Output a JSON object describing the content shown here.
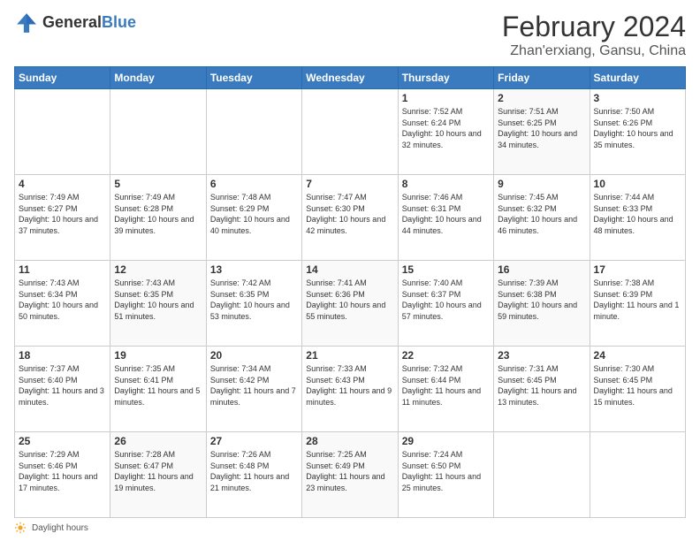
{
  "header": {
    "logo_general": "General",
    "logo_blue": "Blue",
    "title": "February 2024",
    "location": "Zhan'erxiang, Gansu, China"
  },
  "weekdays": [
    "Sunday",
    "Monday",
    "Tuesday",
    "Wednesday",
    "Thursday",
    "Friday",
    "Saturday"
  ],
  "weeks": [
    [
      {
        "day": "",
        "info": ""
      },
      {
        "day": "",
        "info": ""
      },
      {
        "day": "",
        "info": ""
      },
      {
        "day": "",
        "info": ""
      },
      {
        "day": "1",
        "info": "Sunrise: 7:52 AM\nSunset: 6:24 PM\nDaylight: 10 hours and 32 minutes."
      },
      {
        "day": "2",
        "info": "Sunrise: 7:51 AM\nSunset: 6:25 PM\nDaylight: 10 hours and 34 minutes."
      },
      {
        "day": "3",
        "info": "Sunrise: 7:50 AM\nSunset: 6:26 PM\nDaylight: 10 hours and 35 minutes."
      }
    ],
    [
      {
        "day": "4",
        "info": "Sunrise: 7:49 AM\nSunset: 6:27 PM\nDaylight: 10 hours and 37 minutes."
      },
      {
        "day": "5",
        "info": "Sunrise: 7:49 AM\nSunset: 6:28 PM\nDaylight: 10 hours and 39 minutes."
      },
      {
        "day": "6",
        "info": "Sunrise: 7:48 AM\nSunset: 6:29 PM\nDaylight: 10 hours and 40 minutes."
      },
      {
        "day": "7",
        "info": "Sunrise: 7:47 AM\nSunset: 6:30 PM\nDaylight: 10 hours and 42 minutes."
      },
      {
        "day": "8",
        "info": "Sunrise: 7:46 AM\nSunset: 6:31 PM\nDaylight: 10 hours and 44 minutes."
      },
      {
        "day": "9",
        "info": "Sunrise: 7:45 AM\nSunset: 6:32 PM\nDaylight: 10 hours and 46 minutes."
      },
      {
        "day": "10",
        "info": "Sunrise: 7:44 AM\nSunset: 6:33 PM\nDaylight: 10 hours and 48 minutes."
      }
    ],
    [
      {
        "day": "11",
        "info": "Sunrise: 7:43 AM\nSunset: 6:34 PM\nDaylight: 10 hours and 50 minutes."
      },
      {
        "day": "12",
        "info": "Sunrise: 7:43 AM\nSunset: 6:35 PM\nDaylight: 10 hours and 51 minutes."
      },
      {
        "day": "13",
        "info": "Sunrise: 7:42 AM\nSunset: 6:35 PM\nDaylight: 10 hours and 53 minutes."
      },
      {
        "day": "14",
        "info": "Sunrise: 7:41 AM\nSunset: 6:36 PM\nDaylight: 10 hours and 55 minutes."
      },
      {
        "day": "15",
        "info": "Sunrise: 7:40 AM\nSunset: 6:37 PM\nDaylight: 10 hours and 57 minutes."
      },
      {
        "day": "16",
        "info": "Sunrise: 7:39 AM\nSunset: 6:38 PM\nDaylight: 10 hours and 59 minutes."
      },
      {
        "day": "17",
        "info": "Sunrise: 7:38 AM\nSunset: 6:39 PM\nDaylight: 11 hours and 1 minute."
      }
    ],
    [
      {
        "day": "18",
        "info": "Sunrise: 7:37 AM\nSunset: 6:40 PM\nDaylight: 11 hours and 3 minutes."
      },
      {
        "day": "19",
        "info": "Sunrise: 7:35 AM\nSunset: 6:41 PM\nDaylight: 11 hours and 5 minutes."
      },
      {
        "day": "20",
        "info": "Sunrise: 7:34 AM\nSunset: 6:42 PM\nDaylight: 11 hours and 7 minutes."
      },
      {
        "day": "21",
        "info": "Sunrise: 7:33 AM\nSunset: 6:43 PM\nDaylight: 11 hours and 9 minutes."
      },
      {
        "day": "22",
        "info": "Sunrise: 7:32 AM\nSunset: 6:44 PM\nDaylight: 11 hours and 11 minutes."
      },
      {
        "day": "23",
        "info": "Sunrise: 7:31 AM\nSunset: 6:45 PM\nDaylight: 11 hours and 13 minutes."
      },
      {
        "day": "24",
        "info": "Sunrise: 7:30 AM\nSunset: 6:45 PM\nDaylight: 11 hours and 15 minutes."
      }
    ],
    [
      {
        "day": "25",
        "info": "Sunrise: 7:29 AM\nSunset: 6:46 PM\nDaylight: 11 hours and 17 minutes."
      },
      {
        "day": "26",
        "info": "Sunrise: 7:28 AM\nSunset: 6:47 PM\nDaylight: 11 hours and 19 minutes."
      },
      {
        "day": "27",
        "info": "Sunrise: 7:26 AM\nSunset: 6:48 PM\nDaylight: 11 hours and 21 minutes."
      },
      {
        "day": "28",
        "info": "Sunrise: 7:25 AM\nSunset: 6:49 PM\nDaylight: 11 hours and 23 minutes."
      },
      {
        "day": "29",
        "info": "Sunrise: 7:24 AM\nSunset: 6:50 PM\nDaylight: 11 hours and 25 minutes."
      },
      {
        "day": "",
        "info": ""
      },
      {
        "day": "",
        "info": ""
      }
    ]
  ],
  "footer": {
    "daylight_label": "Daylight hours"
  }
}
